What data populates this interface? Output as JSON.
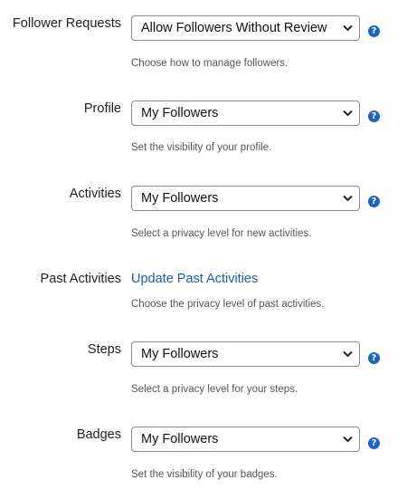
{
  "settings": [
    {
      "label": "Follower Requests",
      "value": "Allow Followers Without Review",
      "hint": "Choose how to manage followers."
    },
    {
      "label": "Profile",
      "value": "My Followers",
      "hint": "Set the visibility of your profile."
    },
    {
      "label": "Activities",
      "value": "My Followers",
      "hint": "Select a privacy level for new activities."
    },
    {
      "label": "Past Activities",
      "link": "Update Past Activities",
      "hint": "Choose the privacy level of past activities."
    },
    {
      "label": "Steps",
      "value": "My Followers",
      "hint": "Select a privacy level for your steps."
    },
    {
      "label": "Badges",
      "value": "My Followers",
      "hint": "Set the visibility of your badges."
    }
  ],
  "help_glyph": "?",
  "colors": {
    "accent": "#1a66c2",
    "link": "#1a5fb4",
    "hint": "#555555"
  }
}
